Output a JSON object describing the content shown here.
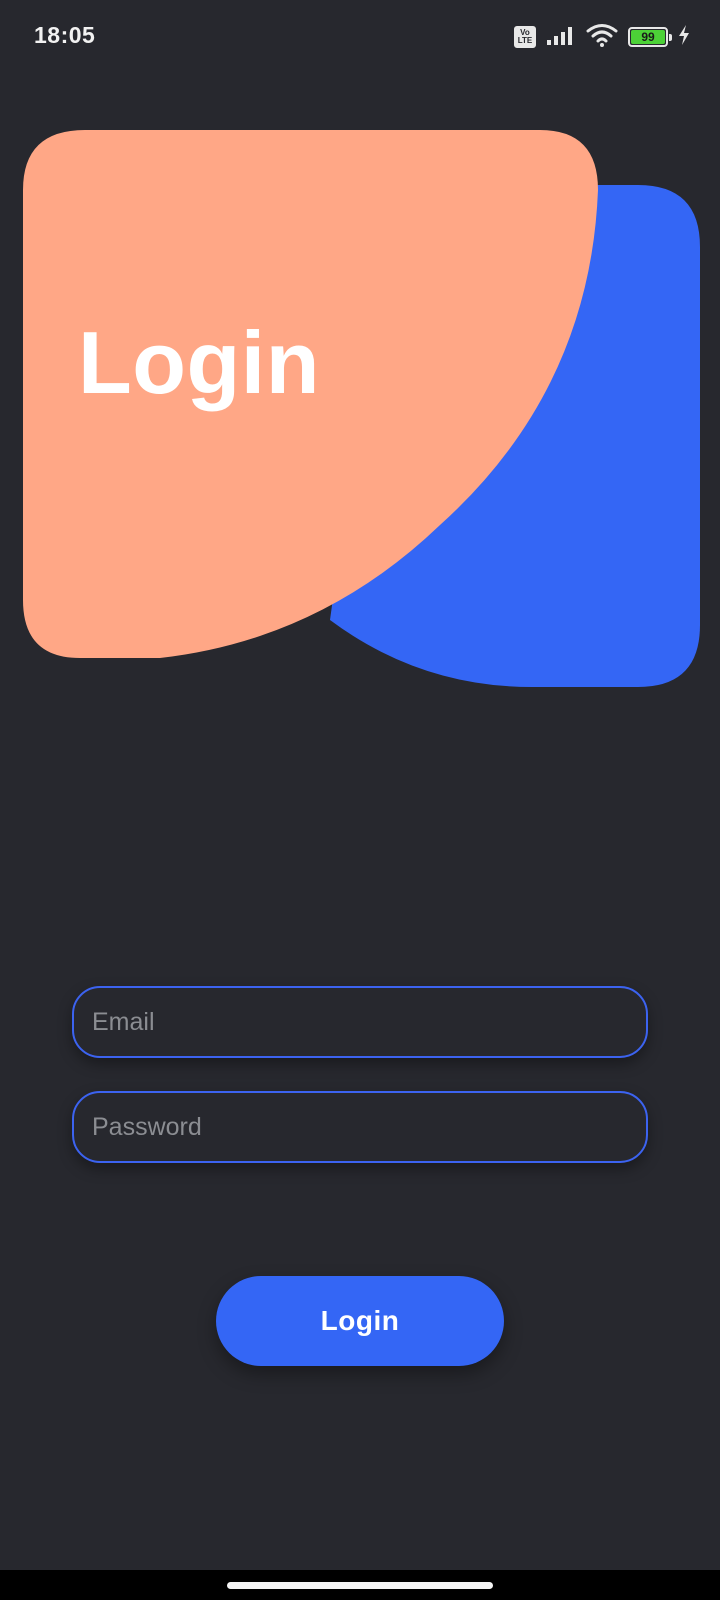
{
  "status_bar": {
    "time": "18:05",
    "volte_label": "Vo LTE",
    "battery_level": "99",
    "icons": [
      "volte-icon",
      "signal-icon",
      "wifi-icon",
      "battery-icon",
      "charging-icon"
    ]
  },
  "hero": {
    "title": "Login",
    "colors": {
      "peach": "#ffa786",
      "blue": "#3466f5"
    }
  },
  "form": {
    "email_placeholder": "Email",
    "password_placeholder": "Password",
    "login_label": "Login"
  },
  "theme": {
    "background": "#27282e",
    "accent": "#3466f5"
  }
}
